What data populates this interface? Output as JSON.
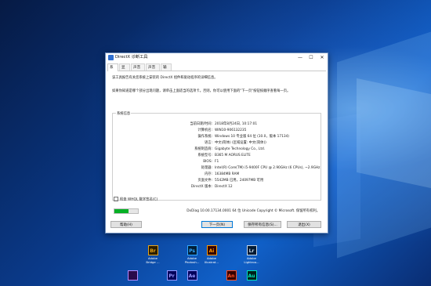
{
  "window": {
    "title": "DirectX 诊断工具",
    "minimize": "—",
    "maximize": "☐",
    "close": "✕"
  },
  "tabs": [
    {
      "label": "系统",
      "active": true
    },
    {
      "label": "显示",
      "active": false
    },
    {
      "label": "声音 1",
      "active": false
    },
    {
      "label": "声音 2",
      "active": false
    },
    {
      "label": "输入",
      "active": false
    }
  ],
  "intro": {
    "line1": "该工具报告有关您系统上安装的 DirectX 组件和驱动程序的详细信息。",
    "line2": "如果你知道是哪个部分出现问题，请单击上面适当的选项卡。否则，你可以使用下面的\"下一页\"按钮按顺序查看每一页。"
  },
  "system_info": {
    "title": "系统信息",
    "rows": [
      {
        "label": "当前日期/时间:",
        "value": "2018年8月24日, 10:17:01"
      },
      {
        "label": "计算机名:",
        "value": "WIN10-906132235"
      },
      {
        "label": "操作系统:",
        "value": "Windows 10 专业版 64 位 (10.0，版本 17134)"
      },
      {
        "label": "语言:",
        "value": "中文(简体) (区域设置: 中文(简体))"
      },
      {
        "label": "系统制造商:",
        "value": "Gigabyte Technology Co., Ltd."
      },
      {
        "label": "系统型号:",
        "value": "B365 M AORUS ELITE"
      },
      {
        "label": "BIOS:",
        "value": "F1"
      },
      {
        "label": "处理器:",
        "value": "Intel(R) Core(TM) i5-9400F CPU @ 2.90GHz (6 CPUs), ~2.9GHz"
      },
      {
        "label": "内存:",
        "value": "16384MB RAM"
      },
      {
        "label": "页面文件:",
        "value": "5542MB 已用，24097MB 可用"
      },
      {
        "label": "DirectX 版本:",
        "value": "DirectX 12"
      }
    ]
  },
  "whql_check": {
    "label": "检查 WHQL 数字签名(C)",
    "checked": false
  },
  "progress": {
    "fraction": 0.6,
    "color": "#06b025"
  },
  "copyright": "DxDiag 10.00.17134.0001 64 位 Unicode  Copyright © Microsoft. 保留所有权利。",
  "buttons": {
    "help": "帮助(H)",
    "next": "下一页(N)",
    "save": "保存所有信息(S)...",
    "exit": "退出(X)"
  },
  "desktop_icons": [
    {
      "abbr": "Br",
      "label1": "Adobe",
      "label2": "Bridge ...",
      "color": "#e8a317",
      "bg": "#2a1d00"
    },
    {
      "abbr": "Ps",
      "label1": "Adobe",
      "label2": "Photosh...",
      "color": "#31a8ff",
      "bg": "#001e36"
    },
    {
      "abbr": "Ai",
      "label1": "Adobe",
      "label2": "Illustrat...",
      "color": "#ff9a00",
      "bg": "#330000"
    },
    {
      "abbr": "Lr",
      "label1": "Adobe",
      "label2": "Lightroo...",
      "color": "#c8d6e6",
      "bg": "#001a33"
    },
    {
      "abbr": "",
      "label1": "",
      "label2": "",
      "color": "#b58cff",
      "bg": "#2a0a4a"
    },
    {
      "abbr": "Pr",
      "label1": "",
      "label2": "",
      "color": "#9999ff",
      "bg": "#00005b"
    },
    {
      "abbr": "Ae",
      "label1": "",
      "label2": "",
      "color": "#9999ff",
      "bg": "#00005b"
    },
    {
      "abbr": "An",
      "label1": "",
      "label2": "",
      "color": "#ff4f20",
      "bg": "#330000"
    },
    {
      "abbr": "Au",
      "label1": "",
      "label2": "",
      "color": "#00e4bb",
      "bg": "#00201a"
    }
  ]
}
